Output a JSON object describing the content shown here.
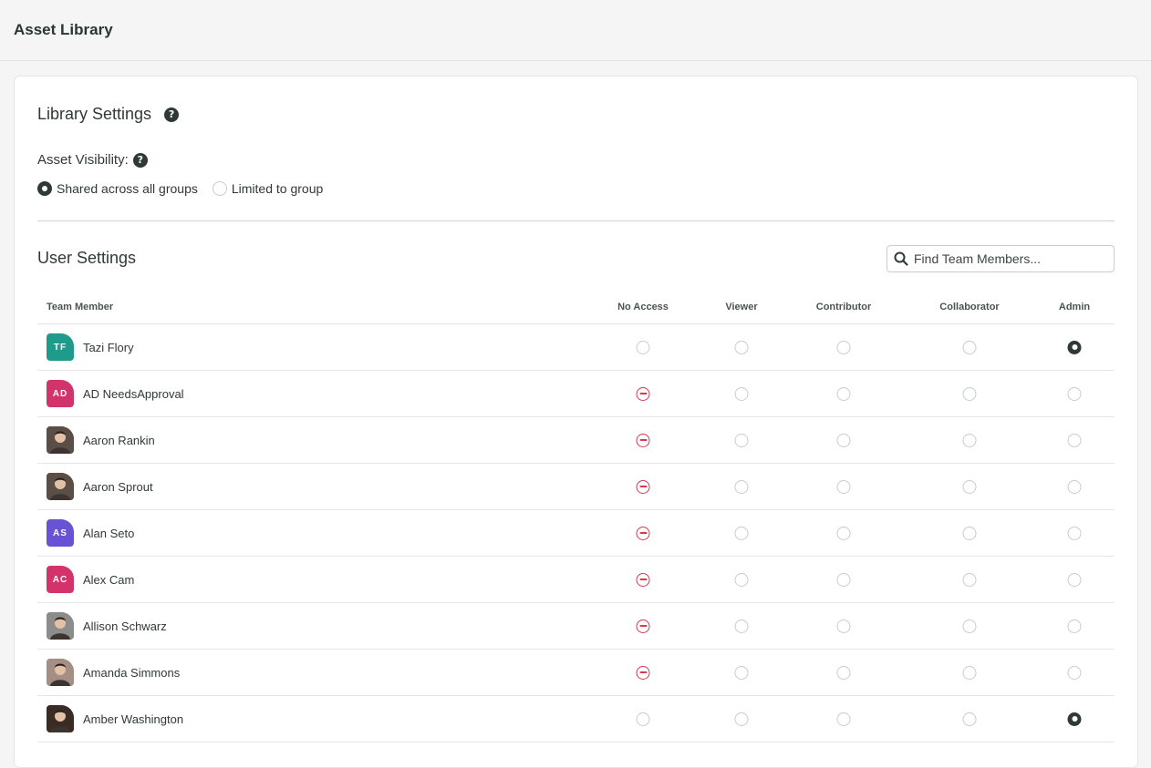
{
  "app": {
    "title": "Asset Library"
  },
  "library": {
    "title": "Library Settings",
    "visibility_label": "Asset Visibility:",
    "options": [
      {
        "label": "Shared across all groups",
        "selected": true
      },
      {
        "label": "Limited to group",
        "selected": false
      }
    ]
  },
  "users": {
    "title": "User Settings",
    "search_placeholder": "Find Team Members...",
    "columns": [
      "Team Member",
      "No Access",
      "Viewer",
      "Contributor",
      "Collaborator",
      "Admin"
    ],
    "rows": [
      {
        "name": "Tazi Flory",
        "initials": "TF",
        "avatar_color": "#1e9b8a",
        "role": "Admin"
      },
      {
        "name": "AD NeedsApproval",
        "initials": "AD",
        "avatar_color": "#d2336b",
        "role": "No Access"
      },
      {
        "name": "Aaron Rankin",
        "initials": "",
        "avatar_color": "#5a4e47",
        "role": "No Access"
      },
      {
        "name": "Aaron Sprout",
        "initials": "",
        "avatar_color": "#5a4e47",
        "role": "No Access"
      },
      {
        "name": "Alan Seto",
        "initials": "AS",
        "avatar_color": "#6a52d4",
        "role": "No Access"
      },
      {
        "name": "Alex Cam",
        "initials": "AC",
        "avatar_color": "#d2336b",
        "role": "No Access"
      },
      {
        "name": "Allison Schwarz",
        "initials": "",
        "avatar_color": "#8c8c8c",
        "role": "No Access"
      },
      {
        "name": "Amanda Simmons",
        "initials": "",
        "avatar_color": "#a58f84",
        "role": "No Access"
      },
      {
        "name": "Amber Washington",
        "initials": "",
        "avatar_color": "#3a2c25",
        "role": "Admin"
      }
    ]
  }
}
